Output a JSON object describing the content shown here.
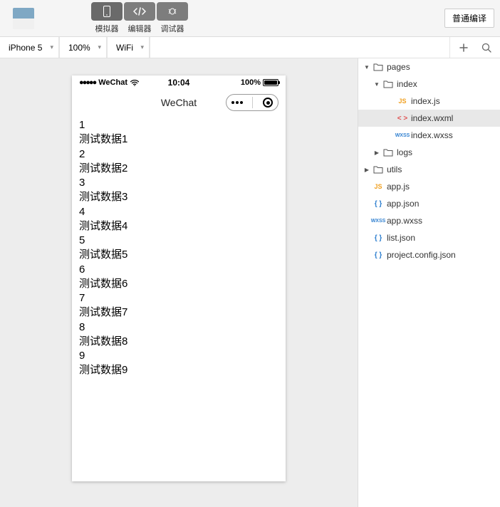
{
  "toolbar": {
    "simulator_label": "模拟器",
    "editor_label": "编辑器",
    "debugger_label": "调试器",
    "compile_label": "普通编译"
  },
  "subbar": {
    "device": "iPhone 5",
    "zoom": "100%",
    "network": "WiFi"
  },
  "phone": {
    "carrier": "WeChat",
    "time": "10:04",
    "battery_pct": "100%",
    "nav_title": "WeChat",
    "content_lines": [
      "1",
      "测试数据1",
      "2",
      "测试数据2",
      "3",
      "测试数据3",
      "4",
      "测试数据4",
      "5",
      "测试数据5",
      "6",
      "测试数据6",
      "7",
      "测试数据7",
      "8",
      "测试数据8",
      "9",
      "测试数据9"
    ]
  },
  "tree": [
    {
      "name": "pages",
      "type": "folder",
      "open": true,
      "indent": 0,
      "caret": "▼"
    },
    {
      "name": "index",
      "type": "folder",
      "open": true,
      "indent": 1,
      "caret": "▼"
    },
    {
      "name": "index.js",
      "type": "js",
      "indent": 2
    },
    {
      "name": "index.wxml",
      "type": "wxml",
      "indent": 2,
      "selected": true
    },
    {
      "name": "index.wxss",
      "type": "wxss",
      "indent": 2
    },
    {
      "name": "logs",
      "type": "folder",
      "open": false,
      "indent": 1,
      "caret": "▶"
    },
    {
      "name": "utils",
      "type": "folder",
      "open": false,
      "indent": 0,
      "caret": "▶"
    },
    {
      "name": "app.js",
      "type": "js",
      "indent": 0
    },
    {
      "name": "app.json",
      "type": "json",
      "indent": 0
    },
    {
      "name": "app.wxss",
      "type": "wxss",
      "indent": 0
    },
    {
      "name": "list.json",
      "type": "json",
      "indent": 0
    },
    {
      "name": "project.config.json",
      "type": "json",
      "indent": 0
    }
  ],
  "icons": {
    "js": "JS",
    "wxml": "< >",
    "wxss": "WXSS",
    "json": "{ }"
  }
}
